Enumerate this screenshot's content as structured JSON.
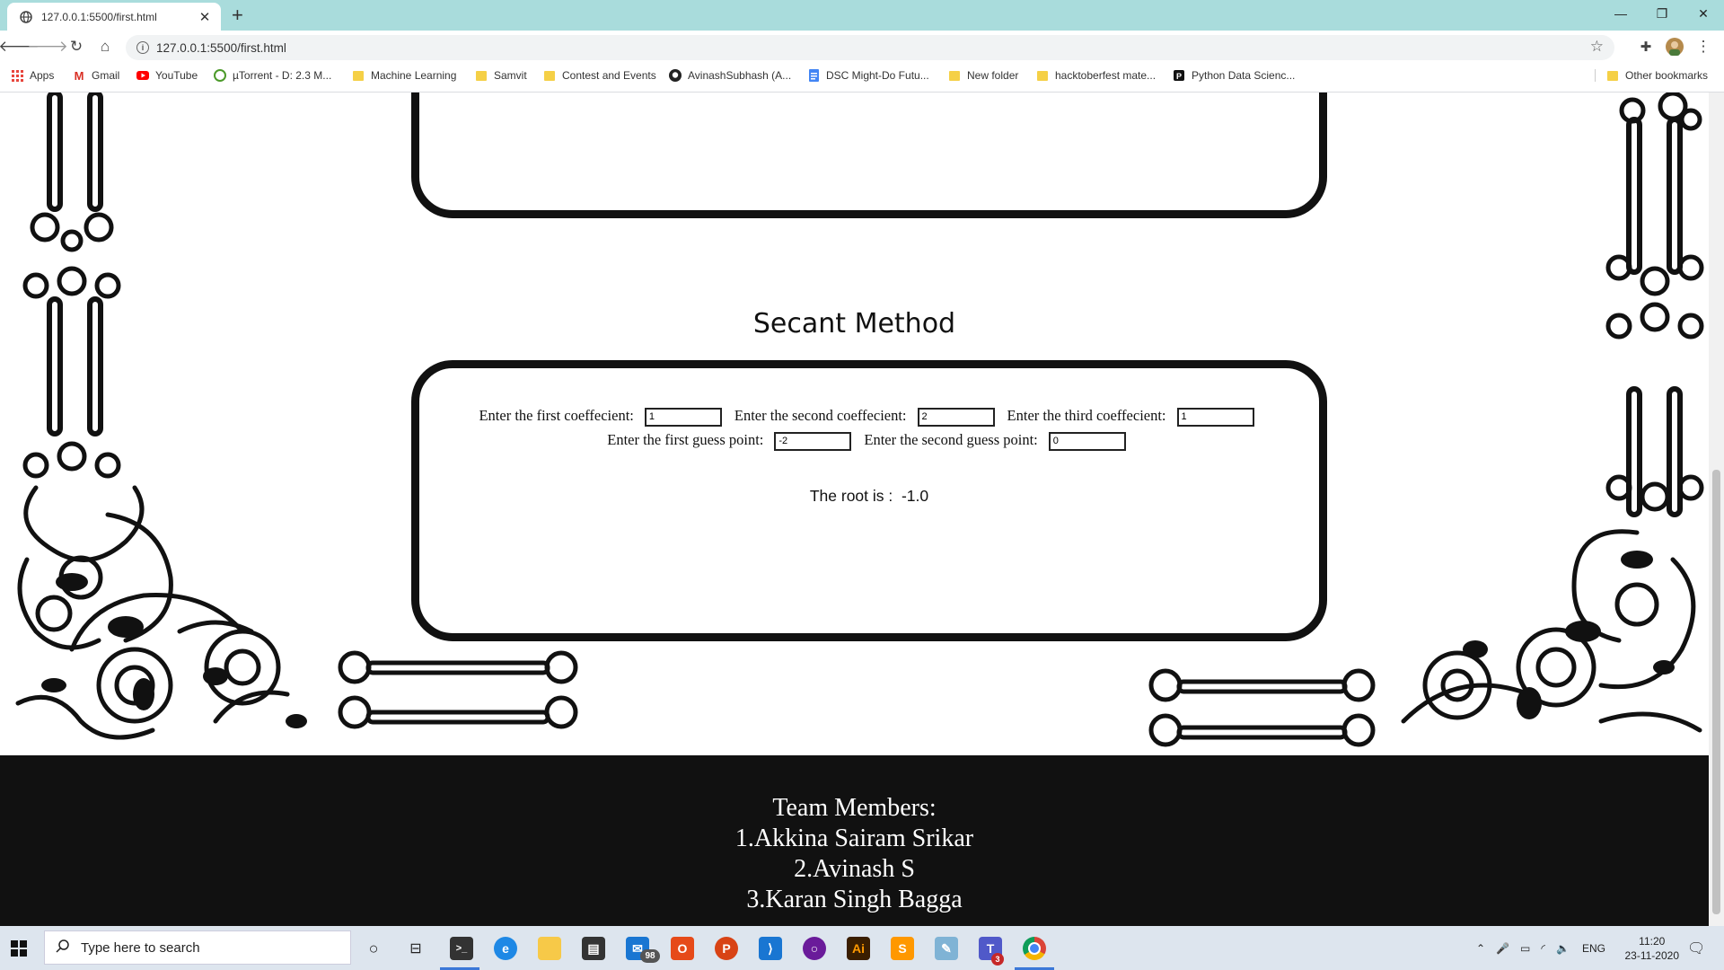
{
  "browser": {
    "tab_title": "127.0.0.1:5500/first.html",
    "url": "127.0.0.1:5500/first.html",
    "bookmarks": [
      {
        "label": "Apps",
        "icon": "apps-grid-icon"
      },
      {
        "label": "Gmail",
        "icon": "gmail-icon"
      },
      {
        "label": "YouTube",
        "icon": "youtube-icon"
      },
      {
        "label": "µTorrent - D: 2.3 M...",
        "icon": "utorrent-icon"
      },
      {
        "label": "Machine Learning",
        "icon": "folder-icon"
      },
      {
        "label": "Samvit",
        "icon": "folder-icon"
      },
      {
        "label": "Contest and Events",
        "icon": "folder-icon"
      },
      {
        "label": "AvinashSubhash (A...",
        "icon": "github-icon"
      },
      {
        "label": "DSC Might-Do Futu...",
        "icon": "google-docs-icon"
      },
      {
        "label": "New folder",
        "icon": "folder-icon"
      },
      {
        "label": "hacktoberfest mate...",
        "icon": "folder-icon"
      },
      {
        "label": "Python Data Scienc...",
        "icon": "page-icon"
      }
    ],
    "other_bookmarks": "Other bookmarks"
  },
  "page": {
    "section_title": "Secant Method",
    "fields": [
      {
        "label": "Enter the first coeffecient:",
        "value": "1"
      },
      {
        "label": "Enter the second coeffecient:",
        "value": "2"
      },
      {
        "label": "Enter the third coeffecient:",
        "value": "1"
      },
      {
        "label": "Enter the first guess point:",
        "value": "-2"
      },
      {
        "label": "Enter the second guess point:",
        "value": "0"
      }
    ],
    "result_label": "The root is :",
    "result_value": "-1.0",
    "footer": {
      "heading": "Team Members:",
      "members": [
        "1.Akkina Sairam Srikar",
        "2.Avinash S",
        "3.Karan Singh Bagga"
      ]
    }
  },
  "taskbar": {
    "search_placeholder": "Type here to search",
    "mail_badge": "98",
    "teams_badge": "3",
    "language": "ENG",
    "time": "11:20",
    "date": "23-11-2020"
  }
}
